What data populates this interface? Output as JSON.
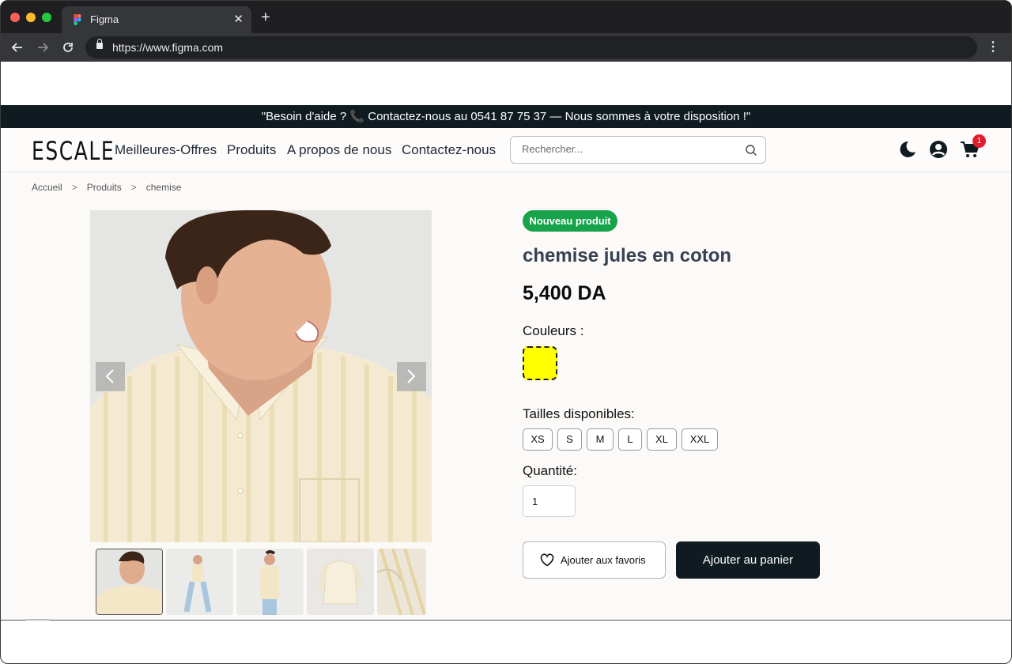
{
  "browser": {
    "tab_title": "Figma",
    "tab_close": "✕",
    "new_tab": "+",
    "url": "https://www.figma.com"
  },
  "announcement": {
    "before_phone": "\"Besoin d'aide ? ",
    "phone_icon": "📞",
    "after_phone": " Contactez-nous au 0541 87 75 37 — Nous sommes à votre disposition !\""
  },
  "header": {
    "logo": "ESCALE",
    "nav": [
      "Meilleures-Offres",
      "Produits",
      "A propos de nous",
      "Contactez-nous"
    ],
    "search_placeholder": "Rechercher...",
    "cart_count": "1",
    "icons": [
      "moon-icon",
      "user-icon",
      "cart-icon"
    ]
  },
  "breadcrumb": [
    "Accueil",
    "Produits",
    "chemise"
  ],
  "breadcrumb_separator": ">",
  "product": {
    "badge": "Nouveau produit",
    "title": "chemise jules en coton",
    "price": "5,400 DA",
    "colors_label": "Couleurs :",
    "colors": [
      "#ffff00"
    ],
    "sizes_label": "Tailles disponibles:",
    "sizes": [
      "XS",
      "S",
      "M",
      "L",
      "XL",
      "XXL"
    ],
    "quantity_label": "Quantité:",
    "quantity": "1",
    "favorite_label": "Ajouter aux favoris",
    "cart_label": "Ajouter au panier"
  },
  "colors": {
    "accent_dark": "#0f1b21",
    "badge_green": "#16a34a",
    "cart_badge": "#e11d2a"
  }
}
